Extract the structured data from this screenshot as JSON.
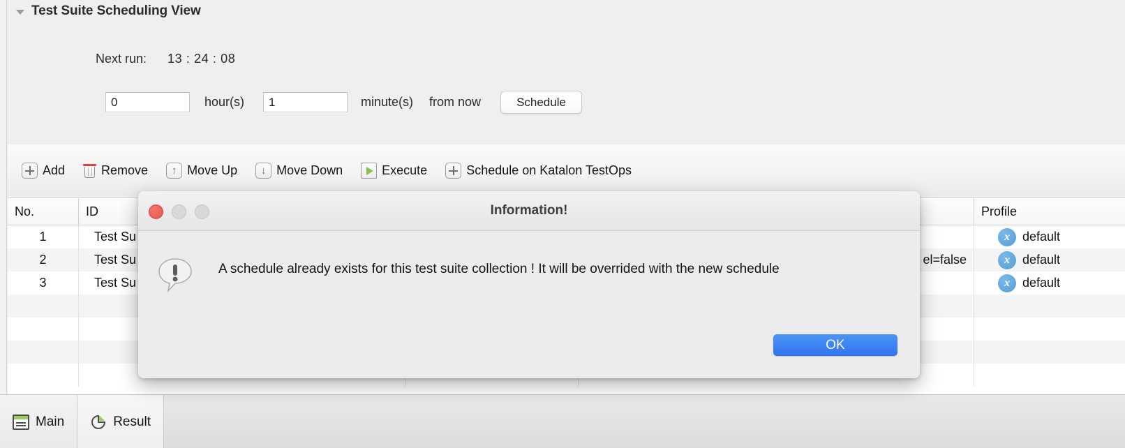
{
  "panel": {
    "title": "Test Suite Scheduling View",
    "twisty_icon": "triangle-down-icon",
    "next_run_label": "Next run:",
    "next_run_value": "13 : 24 : 08",
    "hours_value": "0",
    "hours_label": "hour(s)",
    "minutes_value": "1",
    "minutes_label": "minute(s)",
    "from_now_label": "from now",
    "schedule_button": "Schedule"
  },
  "toolbar": {
    "items": [
      {
        "label": "Add",
        "icon": "plus-box-icon"
      },
      {
        "label": "Remove",
        "icon": "trash-icon"
      },
      {
        "label": "Move Up",
        "icon": "arrow-up-box-icon"
      },
      {
        "label": "Move Down",
        "icon": "arrow-down-box-icon"
      },
      {
        "label": "Execute",
        "icon": "play-box-icon"
      },
      {
        "label": "Schedule on Katalon TestOps",
        "icon": "plus-box-icon"
      }
    ]
  },
  "table": {
    "columns": [
      "No.",
      "ID",
      "",
      "",
      "Profile"
    ],
    "rows": [
      {
        "no": "1",
        "id": "Test Su",
        "col3": "",
        "col4": "",
        "profile": "default",
        "profile_icon": "profile-x-icon"
      },
      {
        "no": "2",
        "id": "Test Su",
        "col3": "",
        "col4": "el=false",
        "profile": "default",
        "profile_icon": "profile-x-icon"
      },
      {
        "no": "3",
        "id": "Test Su",
        "col3": "",
        "col4": "",
        "profile": "default",
        "profile_icon": "profile-x-icon"
      },
      {
        "no": "",
        "id": "",
        "col3": "",
        "col4": "",
        "profile": "",
        "profile_icon": ""
      },
      {
        "no": "",
        "id": "",
        "col3": "",
        "col4": "",
        "profile": "",
        "profile_icon": ""
      },
      {
        "no": "",
        "id": "",
        "col3": "",
        "col4": "",
        "profile": "",
        "profile_icon": ""
      },
      {
        "no": "",
        "id": "",
        "col3": "",
        "col4": "",
        "profile": "",
        "profile_icon": ""
      }
    ]
  },
  "tabs": [
    {
      "label": "Main",
      "icon": "form-list-icon",
      "active": true
    },
    {
      "label": "Result",
      "icon": "pie-chart-icon",
      "active": false
    }
  ],
  "dialog": {
    "title": "Information!",
    "message": "A schedule already exists for this test suite collection ! It will be overrided with the new schedule",
    "icon": "exclamation-bubble-icon",
    "ok_label": "OK",
    "traffic_lights": [
      "close-button",
      "minimize-button-disabled",
      "zoom-button-disabled"
    ]
  },
  "colors": {
    "accent_blue": "#3f84f4",
    "close_red": "#e2574c",
    "profile_blue": "#559ed6",
    "play_green": "#8cc152",
    "trash_red": "#d9443f"
  }
}
